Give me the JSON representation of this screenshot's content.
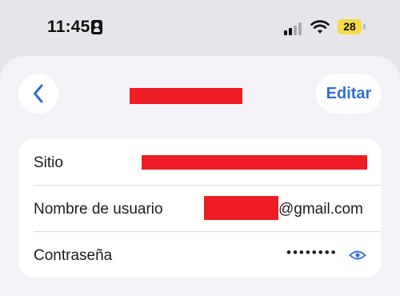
{
  "status_bar": {
    "time": "11:45",
    "battery_level": "28",
    "battery_color": "#f6da45",
    "icons": [
      "person-id-icon",
      "cellular-signal-icon",
      "wifi-icon",
      "battery-icon"
    ]
  },
  "header": {
    "back_icon": "chevron-left-icon",
    "edit_label": "Editar",
    "accent_color": "#2f6fd9"
  },
  "details": {
    "rows": [
      {
        "label": "Sitio"
      },
      {
        "label": "Nombre de usuario",
        "value_suffix": "@gmail.com"
      },
      {
        "label": "Contraseña",
        "value": "••••••••",
        "icon": "eye-icon"
      }
    ]
  },
  "redaction_color": "#ee1c25"
}
